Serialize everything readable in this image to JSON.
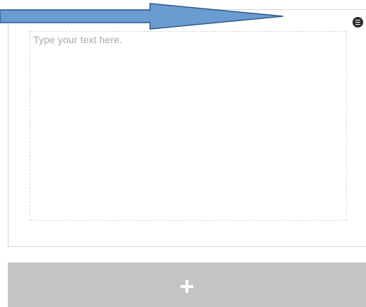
{
  "text_block": {
    "placeholder": "Type your text here.",
    "value": ""
  },
  "block_menu": {
    "icon": "menu-lines-icon"
  },
  "annotation_arrow": {
    "icon": "arrow-right-icon",
    "fill_color": "#6a9bd1",
    "stroke_color": "#2e5b8a"
  },
  "add_block": {
    "icon": "plus-icon",
    "background_color": "#c4c4c4"
  }
}
